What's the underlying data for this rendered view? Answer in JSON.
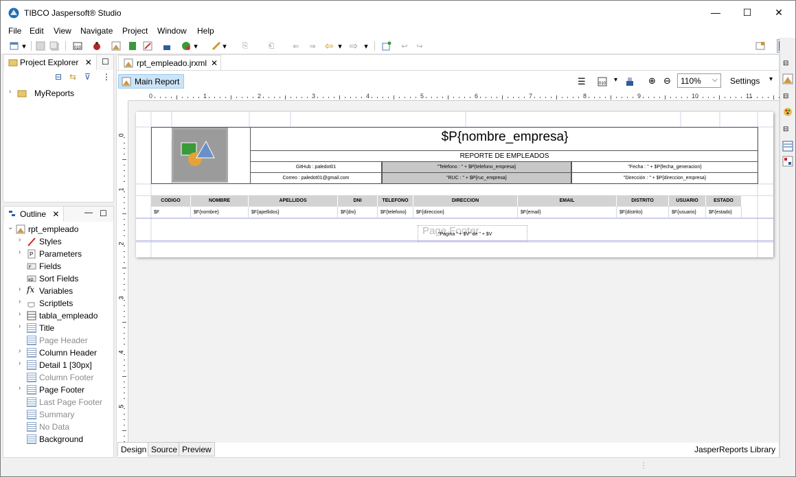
{
  "window": {
    "title": "TIBCO Jaspersoft® Studio",
    "minimize": "—",
    "maximize": "☐",
    "close": "✕"
  },
  "menu": [
    "File",
    "Edit",
    "View",
    "Navigate",
    "Project",
    "Window",
    "Help"
  ],
  "project_explorer": {
    "tab_label": "Project Explorer",
    "items": [
      {
        "label": "MyReports"
      }
    ]
  },
  "outline": {
    "tab_label": "Outline",
    "root": "rpt_empleado",
    "items": [
      {
        "label": "Styles",
        "expandable": true,
        "dim": false,
        "icon": "style-icon"
      },
      {
        "label": "Parameters",
        "expandable": true,
        "dim": false,
        "icon": "parameters-icon"
      },
      {
        "label": "Fields",
        "expandable": false,
        "dim": false,
        "icon": "fields-icon"
      },
      {
        "label": "Sort Fields",
        "expandable": false,
        "dim": false,
        "icon": "sort-fields-icon"
      },
      {
        "label": "Variables",
        "expandable": true,
        "dim": false,
        "icon": "variables-icon"
      },
      {
        "label": "Scriptlets",
        "expandable": true,
        "dim": false,
        "icon": "scriptlets-icon"
      },
      {
        "label": "tabla_empleado",
        "expandable": true,
        "dim": false,
        "icon": "dataset-icon"
      },
      {
        "label": "Title",
        "expandable": true,
        "dim": false,
        "icon": "band-icon"
      },
      {
        "label": "Page Header",
        "expandable": false,
        "dim": true,
        "icon": "band-icon"
      },
      {
        "label": "Column Header",
        "expandable": true,
        "dim": false,
        "icon": "band-icon"
      },
      {
        "label": "Detail 1 [30px]",
        "expandable": true,
        "dim": false,
        "icon": "band-icon"
      },
      {
        "label": "Column Footer",
        "expandable": false,
        "dim": true,
        "icon": "band-icon"
      },
      {
        "label": "Page Footer",
        "expandable": true,
        "dim": false,
        "icon": "band-icon"
      },
      {
        "label": "Last Page Footer",
        "expandable": false,
        "dim": true,
        "icon": "band-icon"
      },
      {
        "label": "Summary",
        "expandable": false,
        "dim": true,
        "icon": "band-icon"
      },
      {
        "label": "No Data",
        "expandable": false,
        "dim": true,
        "icon": "band-icon"
      },
      {
        "label": "Background",
        "expandable": false,
        "dim": false,
        "icon": "band-icon"
      }
    ]
  },
  "editor": {
    "file_tab": "rpt_empleado.jrxml",
    "main_report": "Main Report",
    "zoom": "110%",
    "settings": "Settings",
    "bottom_tabs": [
      "Design",
      "Source",
      "Preview"
    ],
    "library_link": "JasperReports Library",
    "ruler_h": [
      "0",
      "1",
      "2",
      "3",
      "4",
      "5",
      "6",
      "7",
      "8",
      "9",
      "10",
      "11"
    ],
    "ruler_v": [
      "0",
      "1",
      "2",
      "3",
      "4",
      "5"
    ]
  },
  "report": {
    "company": "$P{nombre_empresa}",
    "subtitle": "REPORTE DE EMPLEADOS",
    "github": "GitHub :    paledot01",
    "email": "Correo :    paledot01@gmail.com",
    "telefono": "\"Telefono : \" + $P{telefono_empresa}",
    "ruc": "\"RUC : \" + $P{ruc_empresa}",
    "fecha": "\"Fecha : \" + $P{fecha_generacion}",
    "direccion": "\"Dirección : \" + $P{direccion_empresa}",
    "columns": [
      "CODIGO",
      "NOMBRE",
      "APELLIDOS",
      "DNI",
      "TELEFONO",
      "DIRECCION",
      "EMAIL",
      "DISTRITO",
      "USUARIO",
      "ESTADO"
    ],
    "fields": [
      "$F",
      "$F{nombre}",
      "$F{apellidos}",
      "$F{dni}",
      "$F{telefono}",
      "$F{direccion}",
      "$F{email}",
      "$F{distrito}",
      "$F{usuario}",
      "$F{estado}"
    ],
    "page_footer_label": "Page Footer",
    "page_footer_expr": "\"Página \" + $V\"  de \" + $V"
  },
  "colors": {
    "accent": "#0078d7",
    "header_bg": "#d3d3d3",
    "selected_tab": "#cce4f7"
  }
}
